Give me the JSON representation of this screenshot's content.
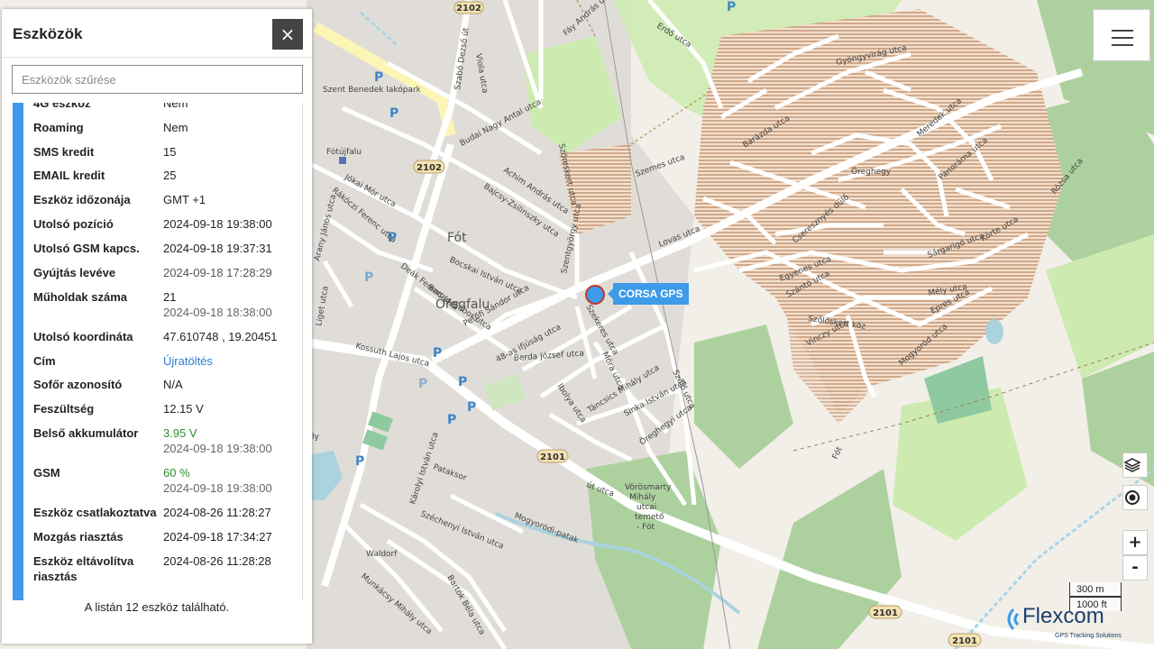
{
  "panel": {
    "title": "Eszközök",
    "close_icon": "×",
    "filter_placeholder": "Eszközök szűrése",
    "rows": [
      {
        "label": "4G eszköz",
        "value": "Nem"
      },
      {
        "label": "Roaming",
        "value": "Nem"
      },
      {
        "label": "SMS kredit",
        "value": "15"
      },
      {
        "label": "EMAIL kredit",
        "value": "25"
      },
      {
        "label": "Eszköz időzonája",
        "value": "GMT +1"
      },
      {
        "label": "Utolsó pozíció",
        "value": "2024-09-18 19:38:00"
      },
      {
        "label": "Utolsó GSM kapcs.",
        "value": "2024-09-18 19:37:31"
      },
      {
        "label": "Gyújtás levéve",
        "value": "2024-09-18 17:28:29"
      },
      {
        "label": "Műholdak száma",
        "value": "21",
        "sub": "2024-09-18 18:38:00"
      },
      {
        "label": "Utolsó koordináta",
        "value": "47.610748 , 19.20451"
      },
      {
        "label": "Cím",
        "value": "Újratöltés"
      },
      {
        "label": "Sofőr azonosító",
        "value": "N/A"
      },
      {
        "label": "Feszültség",
        "value": "12.15 V"
      },
      {
        "label": "Belső akkumulátor",
        "value": "3.95 V",
        "sub": "2024-09-18 19:38:00"
      },
      {
        "label": "GSM",
        "value": "60 %",
        "sub": "2024-09-18 19:38:00"
      },
      {
        "label": "Eszköz csatlakoztatva",
        "value": "2024-08-26 11:28:27"
      },
      {
        "label": "Mozgás riasztás",
        "value": "2024-09-18 17:34:27"
      },
      {
        "label": "Eszköz eltávolítva riasztás",
        "value": "2024-08-26 11:28:28"
      }
    ],
    "footer": "A listán 12 eszköz található."
  },
  "map": {
    "device_label": "CORSA GPS",
    "zoom_in": "+",
    "zoom_out": "-",
    "scale_metric": "300 m",
    "scale_imperial": "1000 ft",
    "brand_name": "Flexcom",
    "brand_tagline": "GPS Tracking Solutions",
    "places": {
      "fot": "Fót",
      "oregfalu": "Öregfalu",
      "oreghegy": "Öreghegy",
      "fotujfalu": "Fótújfalu",
      "waldorf": "Waldorf",
      "cemetery1": "Vörösmarty",
      "cemetery2": "Mihály",
      "cemetery3": "utcai",
      "cemetery4": "temető",
      "cemetery5": "- Fót",
      "szent_benedek": "Szent Benedek lakópark",
      "fot_region": "Fót",
      "ly": "ly"
    },
    "streets": {
      "kossuth": "Kossuth Lajos utca",
      "karolyi": "Károlyi István utca",
      "szabo": "Szabó Dezső út",
      "budai": "Budai Nagy Antal utca",
      "jokai": "Jókai Mór utca",
      "rakoczi": "Rákóczi Ferenc utca",
      "arany": "Arany János utca",
      "liget": "Liget utca",
      "deak": "Deák Ferenc utca",
      "bocskai": "Bocskai István utca",
      "baross": "Baross Gábor utca",
      "petofi": "Petőfi Sándor utca",
      "ifjusag": "48-as ifjúság utca",
      "berda": "Berda József utca",
      "ibolya": "Ibolya utca",
      "tancsics": "Táncsics Mihály utca",
      "szekeres": "Szekeres utca",
      "mora": "Móra utca",
      "sinka": "Sinka István utca",
      "oreghegyi": "Öreghegyi utca",
      "szolo": "Szőlő utca",
      "szentgyorgy": "Szentgyörgy utca",
      "szeneskert": "Szöreskert utca",
      "lovas": "Lovas utca",
      "szemes": "Szemes utca",
      "gyongyvirag": "Gyöngyvirág utca",
      "fay": "Fáy András utca",
      "erdo": "Erdő utca",
      "barazda": "Barázda utca",
      "mogyorod": "Mogyoród utca",
      "pataksor": "Pataksor",
      "szechenyi": "Széchenyi István utca",
      "bartok": "Bartók Béla utca",
      "munkacsy": "Munkácsy Mihály utca",
      "szoloskert": "Szőlőskert köz",
      "vinczy": "Vinczy utca",
      "ut": "út utca",
      "viola": "Viola utca",
      "achim": "Achim András utca",
      "bajcsy": "Bajcsy-Zsilinszky utca",
      "szechenyi2": "Széchenyi István utca",
      "mogyorodi_patak": "Mogyoródi-patak",
      "egyenes": "Egyenes utca",
      "szanto": "Szántó utca",
      "mely": "Mély utca",
      "epres": "Epres utca",
      "sargarigo": "Sárgarigó utca",
      "panorama": "Panoráma utca",
      "meredek": "Meredek utca",
      "rozsa": "Rózsa utca",
      "cseresznyes": "Cseresznyés dűlő",
      "korte": "Körte utca"
    },
    "road_numbers": [
      "2102",
      "2102",
      "2101",
      "2101",
      "2101"
    ]
  }
}
